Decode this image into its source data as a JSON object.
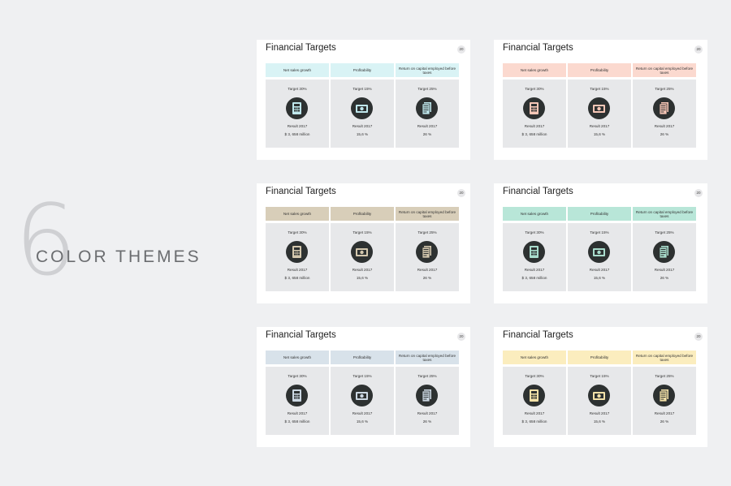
{
  "hero": {
    "number": "6",
    "title": "COLOR THEMES"
  },
  "slides": [
    {
      "title": "Financial Targets",
      "page": "20",
      "accent": "#d9f3f5",
      "icon_fill": "#bfe7ec"
    },
    {
      "title": "Financial Targets",
      "page": "20",
      "accent": "#fbd9cf",
      "icon_fill": "#f6c6b6"
    },
    {
      "title": "Financial Targets",
      "page": "20",
      "accent": "#d8ceb9",
      "icon_fill": "#d4c8ae"
    },
    {
      "title": "Financial Targets",
      "page": "20",
      "accent": "#b8e6d8",
      "icon_fill": "#a9ddcd"
    },
    {
      "title": "Financial Targets",
      "page": "20",
      "accent": "#d8e2ea",
      "icon_fill": "#cbd7e2"
    },
    {
      "title": "Financial Targets",
      "page": "20",
      "accent": "#fbedbe",
      "icon_fill": "#f3e1a8"
    }
  ],
  "columns": [
    {
      "header": "Net sales growth",
      "target": "Target 30%",
      "icon": "calculator-icon",
      "result_label": "Result 2017",
      "result_value": "$ 3, 658 million"
    },
    {
      "header": "Profitability",
      "target": "Target 15%",
      "icon": "money-icon",
      "result_label": "Result 2017",
      "result_value": "15,6 %"
    },
    {
      "header": "Return on capital employed before taxes",
      "target": "Target 25%",
      "icon": "document-icon",
      "result_label": "Result 2017",
      "result_value": "26 %"
    }
  ]
}
